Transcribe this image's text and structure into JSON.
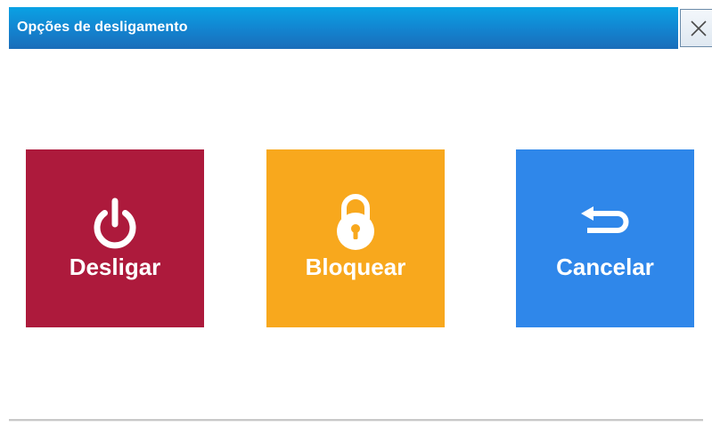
{
  "window": {
    "title": "Opções de desligamento"
  },
  "actions": [
    {
      "label": "Desligar",
      "icon": "power-icon",
      "color": "#ad1a3c"
    },
    {
      "label": "Bloquear",
      "icon": "padlock-icon",
      "color": "#f8a81d"
    },
    {
      "label": "Cancelar",
      "icon": "return-arrow-icon",
      "color": "#2f87ea"
    }
  ],
  "colors": {
    "titlebar_top": "#0aa2e4",
    "titlebar_bottom": "#1a6db9",
    "title_text": "#ffffff"
  }
}
